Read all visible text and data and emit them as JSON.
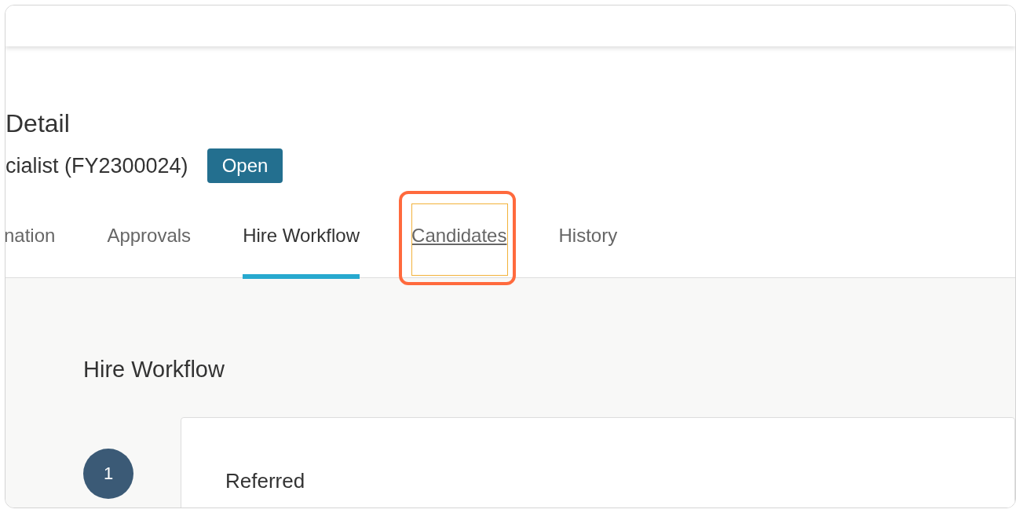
{
  "page": {
    "title": "Detail",
    "subtitle": "cialist (FY2300024)",
    "status_badge": "Open"
  },
  "tabs": [
    {
      "label": "nation",
      "selected": false,
      "highlighted": false
    },
    {
      "label": "Approvals",
      "selected": false,
      "highlighted": false
    },
    {
      "label": "Hire Workflow",
      "selected": true,
      "highlighted": false
    },
    {
      "label": "Candidates",
      "selected": false,
      "highlighted": true
    },
    {
      "label": "History",
      "selected": false,
      "highlighted": false
    }
  ],
  "workflow": {
    "heading": "Hire Workflow",
    "steps": [
      {
        "number": "1",
        "label": "Referred"
      }
    ]
  }
}
